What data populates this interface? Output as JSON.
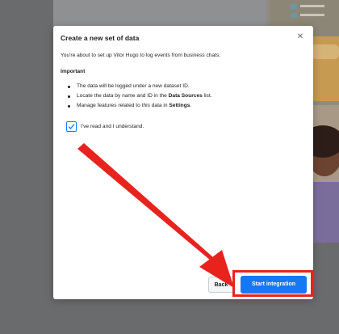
{
  "modal": {
    "title": "Create a new set of data",
    "close_glyph": "✕",
    "intro": "You're about to set up Vitor Hugo to log events from business chats.",
    "section_heading": "Important",
    "bullets": [
      {
        "pre": "The data will be logged under a new dataset ID.",
        "bold": "",
        "post": ""
      },
      {
        "pre": "Locate the data by name and ID in the ",
        "bold": "Data Sources",
        "post": " list."
      },
      {
        "pre": "Manage features related to this data in ",
        "bold": "Settings",
        "post": "."
      }
    ],
    "acknowledgement": {
      "label": "I've read and I understand.",
      "checked": true
    },
    "buttons": {
      "back": "Back",
      "start": "Start integration"
    }
  },
  "annotation": {
    "color": "#e8231e",
    "shape": "arrow-and-box"
  },
  "colors": {
    "primary": "#1877f2",
    "overlay": "#6a6b6d"
  }
}
